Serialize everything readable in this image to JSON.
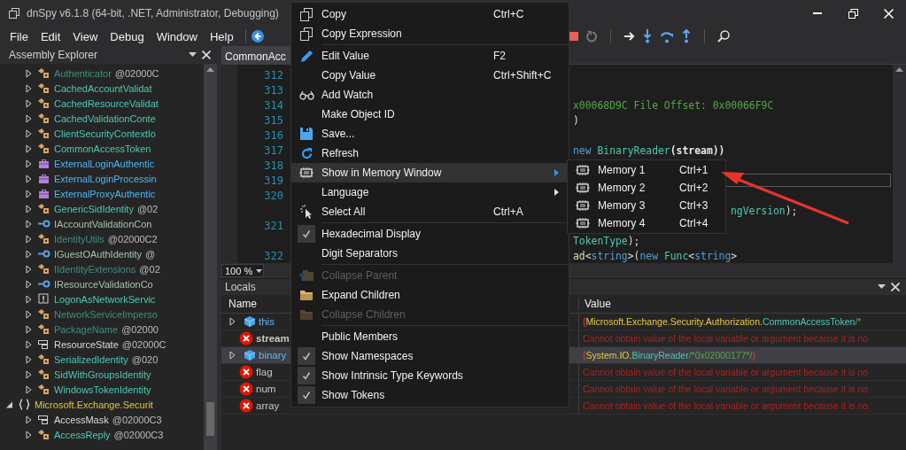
{
  "window": {
    "title": "dnSpy v6.1.8 (64-bit, .NET, Administrator, Debugging)"
  },
  "menu_bar": [
    "File",
    "Edit",
    "View",
    "Debug",
    "Window",
    "Help"
  ],
  "assembly_explorer": {
    "title": "Assembly Explorer",
    "tree": [
      {
        "children": [
          {
            "name": "Authenticator",
            "token": "@02000C",
            "kind": "internal-class",
            "expanded": false
          },
          {
            "name": "CachedAccountValidat",
            "kind": "class",
            "expanded": false
          },
          {
            "name": "CachedResourceValidat",
            "kind": "class",
            "expanded": false
          },
          {
            "name": "CachedValidationConte",
            "kind": "class",
            "expanded": false
          },
          {
            "name": "ClientSecurityContextIo",
            "kind": "class",
            "expanded": false
          },
          {
            "name": "CommonAccessToken",
            "kind": "class",
            "expanded": false
          },
          {
            "name": "ExternalLoginAuthentic",
            "kind": "delegate",
            "expanded": false
          },
          {
            "name": "ExternalLoginProcessin",
            "kind": "delegate",
            "expanded": false
          },
          {
            "name": "ExternalProxyAuthentic",
            "kind": "delegate",
            "expanded": false
          },
          {
            "name": "GenericSidIdentity",
            "token": "@02",
            "kind": "class",
            "expanded": false
          },
          {
            "name": "IAccountValidationCon",
            "kind": "interface",
            "expanded": false
          },
          {
            "name": "IdentityUtils",
            "token": "@02000C2",
            "kind": "internal-class",
            "expanded": false
          },
          {
            "name": "IGuestOAuthIdentity",
            "token": "@",
            "kind": "interface",
            "expanded": false
          },
          {
            "name": "IIdentityExtensions",
            "token": "@02",
            "kind": "internal-class",
            "expanded": false
          },
          {
            "name": "IResourceValidationCo",
            "kind": "interface",
            "expanded": false
          },
          {
            "name": "LogonAsNetworkServic",
            "kind": "exception",
            "expanded": false
          },
          {
            "name": "NetworkServiceImperso",
            "kind": "internal-class",
            "expanded": false
          },
          {
            "name": "PackageName",
            "token": "@02000",
            "kind": "internal-class",
            "expanded": false
          },
          {
            "name": "ResourceState",
            "token": "@02000C",
            "kind": "enum",
            "expanded": false
          },
          {
            "name": "SerializedIdentity",
            "token": "@020",
            "kind": "class",
            "expanded": false
          },
          {
            "name": "SidWithGroupsIdentity",
            "kind": "class",
            "expanded": false
          },
          {
            "name": "WindowsTokenIdentity",
            "kind": "class",
            "expanded": false
          }
        ]
      },
      {
        "name": "Microsoft.Exchange.Securit",
        "kind": "namespace",
        "expanded": true,
        "children": [
          {
            "name": "AccessMask",
            "token": "@02000C3",
            "kind": "enum",
            "expanded": false
          },
          {
            "name": "AccessReply",
            "token": "@02000C3",
            "kind": "class",
            "expanded": false
          }
        ]
      }
    ]
  },
  "editor": {
    "tab": "CommonAcc",
    "zoom": "100 %",
    "lines": [
      {
        "number": "312",
        "current": false
      },
      {
        "number": "313",
        "current": false
      },
      {
        "number": "314",
        "current": false,
        "code": [
          {
            "text": "x00068D9C File Offset: 0x00066F9C",
            "kind": "comment"
          }
        ]
      },
      {
        "number": "315",
        "current": false,
        "code": [
          {
            "text": ")",
            "kind": "plain"
          }
        ]
      },
      {
        "number": "316",
        "current": false
      },
      {
        "number": "317",
        "current": false,
        "code": [
          {
            "text": "new",
            "kind": "keyword"
          },
          {
            "text": " BinaryReader",
            "kind": "type"
          },
          {
            "text": "(stream))",
            "kind": "local"
          }
        ]
      },
      {
        "number": "318",
        "current": false
      },
      {
        "number": "319",
        "current": true
      },
      {
        "number": "320",
        "current": false
      },
      {
        "current": false,
        "code": [
          {
            "text": "ngVersion",
            "kind": "type"
          },
          {
            "text": ");",
            "kind": "plain"
          }
        ]
      },
      {
        "number": "321",
        "current": false
      },
      {
        "current": false,
        "code": [
          {
            "text": "TokenType",
            "kind": "type"
          },
          {
            "text": ");",
            "kind": "plain"
          }
        ]
      },
      {
        "number": "322",
        "current": false,
        "code": [
          {
            "text": "ad",
            "kind": "method"
          },
          {
            "text": "<",
            "kind": "plain"
          },
          {
            "text": "string",
            "kind": "keyword"
          },
          {
            "text": ">(",
            "kind": "plain"
          },
          {
            "text": "new",
            "kind": "keyword"
          },
          {
            "text": " Func",
            "kind": "type"
          },
          {
            "text": "<",
            "kind": "plain"
          },
          {
            "text": "string",
            "kind": "keyword"
          },
          {
            "text": ">",
            "kind": "plain"
          }
        ]
      }
    ]
  },
  "locals": {
    "title": "Locals",
    "columns": [
      "Name",
      "Value"
    ],
    "rows": [
      {
        "name": "this",
        "kind": "object",
        "expandable": true,
        "emphasized": false,
        "selected": false,
        "value": [
          {
            "text": "{",
            "kind": "brace"
          },
          {
            "text": "Microsoft.Exchange.Security.Authorization.",
            "kind": "namespace"
          },
          {
            "text": "CommonAccessToken",
            "kind": "type"
          },
          {
            "text": "/*",
            "kind": "comment"
          }
        ]
      },
      {
        "name": "stream",
        "kind": "error",
        "expandable": false,
        "emphasized": true,
        "selected": false,
        "value": [
          {
            "text": "Cannot obtain value of the local variable or argument because it is no",
            "kind": "error"
          }
        ]
      },
      {
        "name": "binary",
        "kind": "object",
        "expandable": true,
        "emphasized": false,
        "selected": true,
        "value": [
          {
            "text": "{",
            "kind": "brace"
          },
          {
            "text": "System.IO.",
            "kind": "namespace"
          },
          {
            "text": "BinaryReader",
            "kind": "type"
          },
          {
            "text": "/*0x02000177*/",
            "kind": "comment"
          },
          {
            "text": "}",
            "kind": "brace"
          }
        ]
      },
      {
        "name": "flag",
        "kind": "error",
        "expandable": false,
        "emphasized": false,
        "selected": false,
        "value": [
          {
            "text": "Cannot obtain value of the local variable or argument because it is no",
            "kind": "error"
          }
        ]
      },
      {
        "name": "num",
        "kind": "error",
        "expandable": false,
        "emphasized": false,
        "selected": false,
        "value": [
          {
            "text": "Cannot obtain value of the local variable or argument because it is no",
            "kind": "error"
          }
        ]
      },
      {
        "name": "array",
        "kind": "error",
        "expandable": false,
        "emphasized": false,
        "selected": false,
        "value": [
          {
            "text": "Cannot obtain value of the local variable or argument because it is no",
            "kind": "error"
          }
        ]
      }
    ]
  },
  "context_menu": {
    "items": [
      {
        "kind": "command",
        "label": "Copy",
        "shortcut": "Ctrl+C",
        "disabled": false,
        "selected": false,
        "submenu": false
      },
      {
        "kind": "command",
        "label": "Copy Expression",
        "disabled": false,
        "selected": false,
        "submenu": false
      },
      {
        "kind": "separator"
      },
      {
        "kind": "command",
        "label": "Edit Value",
        "shortcut": "F2",
        "disabled": false,
        "selected": false,
        "submenu": false
      },
      {
        "kind": "command",
        "label": "Copy Value",
        "shortcut": "Ctrl+Shift+C",
        "disabled": false,
        "selected": false,
        "submenu": false
      },
      {
        "kind": "command",
        "label": "Add Watch",
        "disabled": false,
        "selected": false,
        "submenu": false
      },
      {
        "kind": "command",
        "label": "Make Object ID",
        "disabled": false,
        "selected": false,
        "submenu": false
      },
      {
        "kind": "command",
        "label": "Save...",
        "disabled": false,
        "selected": false,
        "submenu": false
      },
      {
        "kind": "command",
        "label": "Refresh",
        "disabled": false,
        "selected": false,
        "submenu": false
      },
      {
        "kind": "command",
        "label": "Show in Memory Window",
        "disabled": false,
        "selected": true,
        "submenu": true
      },
      {
        "kind": "command",
        "label": "Language",
        "disabled": false,
        "selected": false,
        "submenu": true
      },
      {
        "kind": "command",
        "label": "Select All",
        "shortcut": "Ctrl+A",
        "disabled": false,
        "selected": false,
        "submenu": false
      },
      {
        "kind": "separator"
      },
      {
        "kind": "check",
        "label": "Hexadecimal Display",
        "checked": true,
        "disabled": false,
        "selected": false
      },
      {
        "kind": "check",
        "label": "Digit Separators",
        "checked": false,
        "disabled": false,
        "selected": false
      },
      {
        "kind": "separator"
      },
      {
        "kind": "command",
        "label": "Collapse Parent",
        "disabled": true,
        "selected": false,
        "submenu": false
      },
      {
        "kind": "command",
        "label": "Expand Children",
        "disabled": false,
        "selected": false,
        "submenu": false
      },
      {
        "kind": "command",
        "label": "Collapse Children",
        "disabled": true,
        "selected": false,
        "submenu": false
      },
      {
        "kind": "separator"
      },
      {
        "kind": "check",
        "label": "Public Members",
        "checked": false,
        "disabled": false,
        "selected": false
      },
      {
        "kind": "check",
        "label": "Show Namespaces",
        "checked": true,
        "disabled": false,
        "selected": false
      },
      {
        "kind": "check",
        "label": "Show Intrinsic Type Keywords",
        "checked": true,
        "disabled": false,
        "selected": false
      },
      {
        "kind": "check",
        "label": "Show Tokens",
        "checked": true,
        "disabled": false,
        "selected": false
      }
    ]
  },
  "submenu": {
    "items": [
      {
        "label": "Memory 1",
        "shortcut": "Ctrl+1"
      },
      {
        "label": "Memory 2",
        "shortcut": "Ctrl+2"
      },
      {
        "label": "Memory 3",
        "shortcut": "Ctrl+3"
      },
      {
        "label": "Memory 4",
        "shortcut": "Ctrl+4"
      }
    ]
  }
}
